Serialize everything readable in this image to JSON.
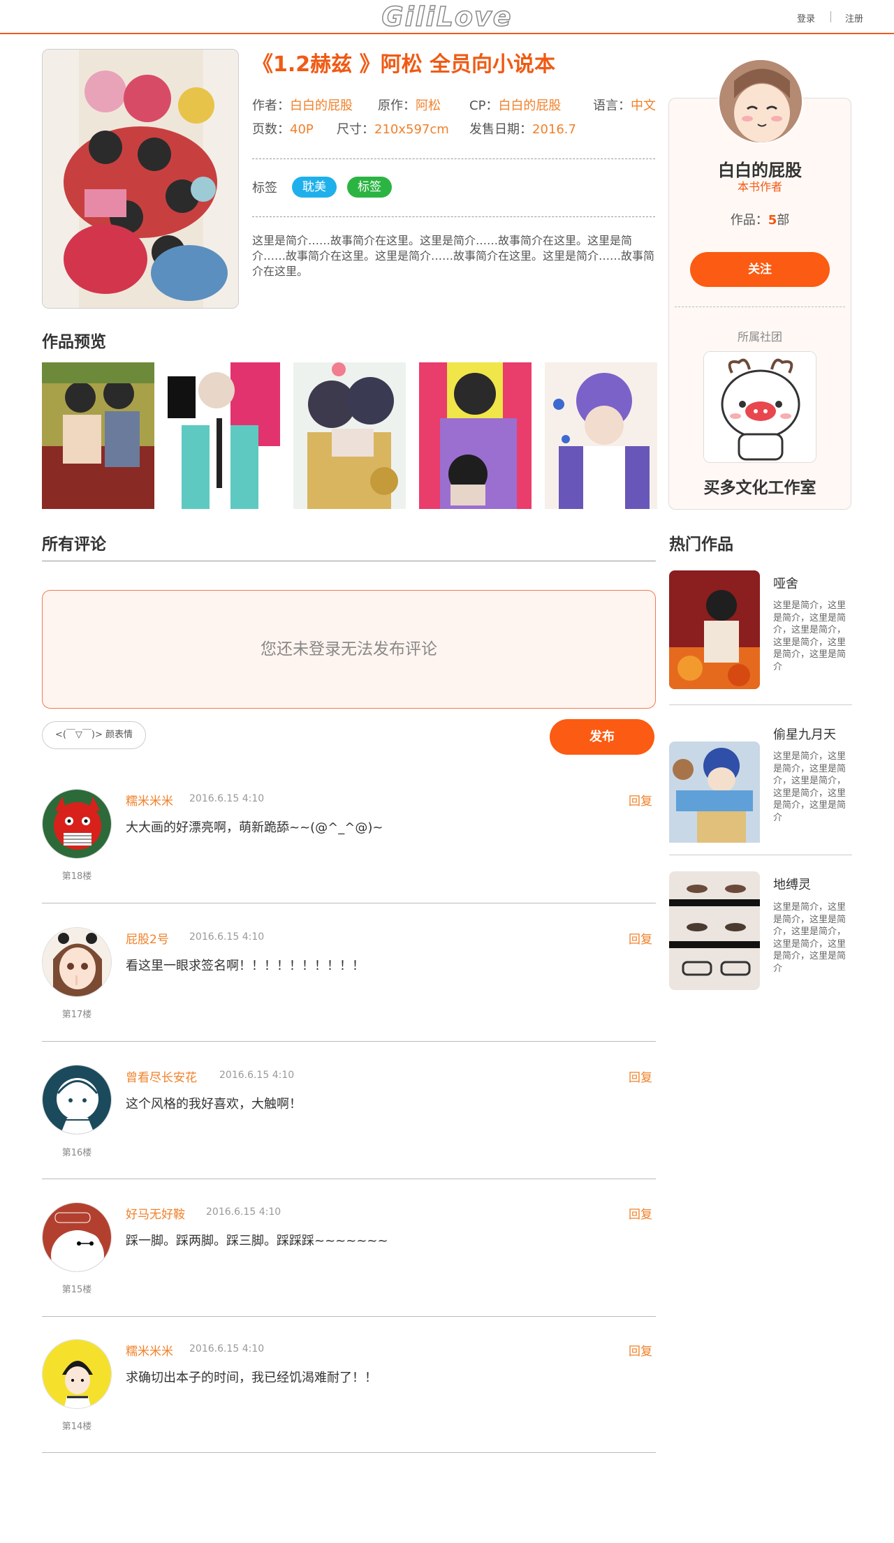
{
  "header": {
    "logo": "GiliLove",
    "login": "登录",
    "register": "注册"
  },
  "book": {
    "title": "《1.2赫兹 》阿松 全员向小说本",
    "author_label": "作者：",
    "author": "白白的屁股",
    "original_label": "原作：",
    "original": "阿松",
    "cp_label": "CP：",
    "cp": "白白的屁股",
    "language_label": "语言：",
    "language": "中文",
    "pages_label": "页数：",
    "pages": "40P",
    "size_label": "尺寸：",
    "size": "210x597cm",
    "date_label": "发售日期：",
    "date": "2016.7",
    "tags_label": "标签",
    "tags": [
      {
        "label": "耽美",
        "color": "#1fb0ec"
      },
      {
        "label": "标签",
        "color": "#2cb443"
      }
    ],
    "description": "这里是简介……故事简介在这里。这里是简介……故事简介在这里。这里是简介……故事简介在这里。这里是简介……故事简介在这里。这里是简介……故事简介在这里。"
  },
  "preview": {
    "title": "作品预览"
  },
  "author_card": {
    "name": "白白的屁股",
    "role": "本书作者",
    "works_label": "作品：",
    "works_count": "5",
    "works_unit": "部",
    "follow": "关注",
    "club_label": "所属社团",
    "club_name": "买多文化工作室"
  },
  "comments": {
    "title": "所有评论",
    "login_notice": "您还未登录无法发布评论",
    "emoji_button": "<(￣▽￣)> 颜表情",
    "publish": "发布",
    "reply_label": "回复",
    "items": [
      {
        "name": "糯米米米",
        "time": "2016.6.15 4:10",
        "text": "大大画的好漂亮啊，萌新跪舔~~(@^_^@)~",
        "floor": "第18楼"
      },
      {
        "name": "屁股2号",
        "time": "2016.6.15 4:10",
        "text": "看这里一眼求签名啊！！！！！！！！！！",
        "floor": "第17楼"
      },
      {
        "name": "曾看尽长安花",
        "time": "2016.6.15 4:10",
        "text": "这个风格的我好喜欢，大触啊！",
        "floor": "第16楼"
      },
      {
        "name": "好马无好鞍",
        "time": "2016.6.15 4:10",
        "text": "踩一脚。踩两脚。踩三脚。踩踩踩~~~~~~~",
        "floor": "第15楼"
      },
      {
        "name": "糯米米米",
        "time": "2016.6.15 4:10",
        "text": "求确切出本子的时间，我已经饥渴难耐了！！",
        "floor": "第14楼"
      }
    ]
  },
  "hot": {
    "title": "热门作品",
    "items": [
      {
        "title": "哑舍",
        "desc": "这里是简介，这里是简介，这里是简介，这里是简介，这里是简介，这里是简介，这里是简介"
      },
      {
        "title": "偷星九月天",
        "desc": "这里是简介，这里是简介，这里是简介，这里是简介，这里是简介，这里是简介，这里是简介"
      },
      {
        "title": "地缚灵",
        "desc": "这里是简介，这里是简介，这里是简介，这里是简介，这里是简介，这里是简介，这里是简介"
      }
    ]
  }
}
